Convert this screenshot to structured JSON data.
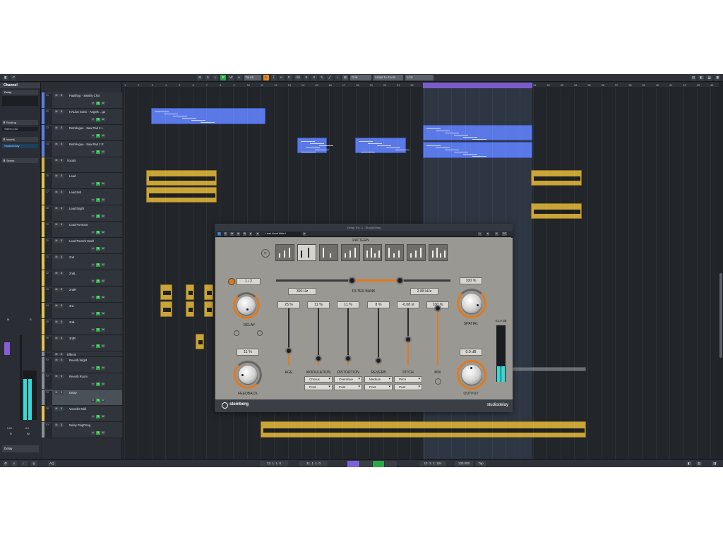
{
  "toolbar": {
    "modes": [
      "M",
      "S",
      "L",
      "R",
      "W",
      "A"
    ],
    "automation_mode": "Touch",
    "grid_type": "Grid",
    "zoom_mode": "Adapt to Zoom",
    "quantize": "1/16"
  },
  "inspector": {
    "tab": "Channel",
    "track_name": "Delay",
    "sections": {
      "routing": "Routing",
      "inserts": "Inserts",
      "sends": "Sends"
    },
    "routing_output": "Stereo Out",
    "insert_slot": "StudioDelay",
    "strip_values": {
      "pan": "0.00",
      "vol": "-0.0",
      "label_a": "R",
      "label_b": "W"
    },
    "bottom_name": "Delay"
  },
  "tracks": [
    {
      "num": "21",
      "name": "Padshop - Swishy Choi",
      "color": "#5c7ce8"
    },
    {
      "num": "22",
      "name": "HALion Sonic - Angels ...ga",
      "color": "#5c7ce8"
    },
    {
      "num": "23",
      "name": "Retrologue - Saw Pad 2 L",
      "color": "#5c7ce8"
    },
    {
      "num": "24",
      "name": "Retrologue - Saw Pad 2 R",
      "color": "#5c7ce8"
    },
    {
      "num": "",
      "name": "Vocals",
      "color": "#d9b13a",
      "folder": true
    },
    {
      "num": "26",
      "name": "Lead",
      "color": "#e6c24a"
    },
    {
      "num": "27",
      "name": "Lead 8vb",
      "color": "#e6c24a"
    },
    {
      "num": "28",
      "name": "Lead bright",
      "color": "#e6c24a"
    },
    {
      "num": "29",
      "name": "Lead Formant",
      "color": "#e6c24a"
    },
    {
      "num": "30",
      "name": "Lead Reverb Swell",
      "color": "#e6c24a"
    },
    {
      "num": "31",
      "name": "2nd",
      "color": "#e6c24a"
    },
    {
      "num": "32",
      "name": "2ndL",
      "color": "#e6c24a"
    },
    {
      "num": "33",
      "name": "2ndR",
      "color": "#e6c24a"
    },
    {
      "num": "34",
      "name": "3rd",
      "color": "#e6c24a"
    },
    {
      "num": "35",
      "name": "3rdL",
      "color": "#e6c24a"
    },
    {
      "num": "36",
      "name": "3rdR",
      "color": "#e6c24a"
    },
    {
      "num": "",
      "name": "Effects",
      "color": "#8b8f96",
      "folder": true
    },
    {
      "num": "FX",
      "name": "Reverb bright",
      "color": "#8b8f96"
    },
    {
      "num": "FX",
      "name": "Reverb Room",
      "color": "#8b8f96"
    },
    {
      "num": "FX",
      "name": "Delay",
      "color": "#8b8f96",
      "selected": true
    },
    {
      "num": "38",
      "name": "Vocoder Midi",
      "color": "#e6c24a"
    },
    {
      "num": "FX",
      "name": "Delay PingPong",
      "color": "#8b8f96"
    }
  ],
  "ruler_ticks": [
    "1",
    "2",
    "3",
    "4",
    "5",
    "6",
    "7",
    "8",
    "9",
    "10",
    "11",
    "12",
    "13",
    "14",
    "15",
    "16",
    "17",
    "18",
    "19",
    "20",
    "21",
    "22",
    "23",
    "24",
    "25",
    "26",
    "27",
    "28",
    "29",
    "30",
    "31",
    "32",
    "33",
    "34",
    "35",
    "36",
    "37",
    "38",
    "39",
    "40",
    "41",
    "42",
    "43",
    "44"
  ],
  "plugin": {
    "window_title": "Delay: Ins. 1 - StudioDelay",
    "preset_name": "Lead Vocal Wide I",
    "pattern_label": "PATTERN",
    "delay_time": "1 / 2",
    "delay_label": "DELAY",
    "filter_low": "390 Hz",
    "filter_bank_label": "FILTER BANK",
    "filter_high": "2.88 kHz",
    "spatial_value": "100 %",
    "spatial_label": "SPATIAL",
    "feedback_value": "11 %",
    "feedback_label": "FEEDBACK",
    "output_value": "0.0 dB",
    "output_label": "OUTPUT",
    "meter_value": "-21.0 dB",
    "meter_level_left": 0.28,
    "meter_level_right": 0.28,
    "fx": [
      {
        "label": "AGE",
        "value": "25 %",
        "level": 0.25,
        "type": "",
        "mode": ""
      },
      {
        "label": "MODULATION",
        "value": "11 %",
        "level": 0.11,
        "type": "Chorus",
        "mode": "Post"
      },
      {
        "label": "DISTORTION",
        "value": "11 %",
        "level": 0.11,
        "type": "Overdrive",
        "mode": "Post"
      },
      {
        "label": "REVERB",
        "value": "8 %",
        "level": 0.08,
        "type": "Medium",
        "mode": "Post"
      },
      {
        "label": "PITCH",
        "value": "-0.08 st",
        "level": 0.45,
        "type": "Pitch",
        "mode": "Post"
      },
      {
        "label": "MIX",
        "value": "100 %",
        "level": 1.0,
        "type": "",
        "mode": ""
      }
    ],
    "brand": "steinberg",
    "product": "studiodelay"
  },
  "transport": {
    "pos_left": "23. 1. 1. 0",
    "pos_right": "31. 1. 1. 0",
    "time_display": "10. 3. 2. 104",
    "tempo": "130.000",
    "tap": "Tap",
    "aq": "AQ"
  },
  "colors": {
    "loop": "#7a5cc9",
    "play": "#2aa845",
    "blue_clip": "#5a78e6",
    "gold_clip": "#c9a437"
  }
}
